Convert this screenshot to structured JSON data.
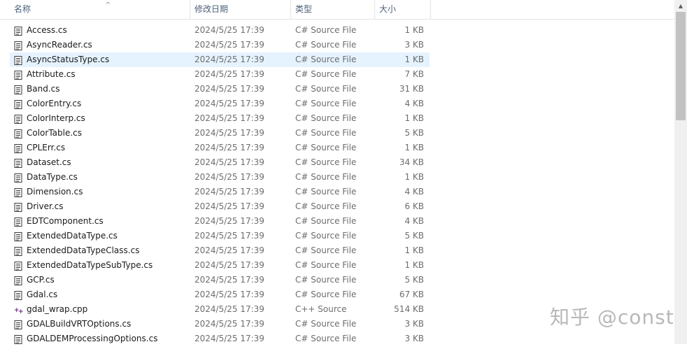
{
  "columns": {
    "name": "名称",
    "date": "修改日期",
    "type": "类型",
    "size": "大小"
  },
  "files": [
    {
      "name": "Access.cs",
      "date": "2024/5/25 17:39",
      "type": "C# Source File",
      "size": "1 KB",
      "icon": "cs-file-icon"
    },
    {
      "name": "AsyncReader.cs",
      "date": "2024/5/25 17:39",
      "type": "C# Source File",
      "size": "3 KB",
      "icon": "cs-file-icon"
    },
    {
      "name": "AsyncStatusType.cs",
      "date": "2024/5/25 17:39",
      "type": "C# Source File",
      "size": "1 KB",
      "icon": "cs-file-icon",
      "selected": true
    },
    {
      "name": "Attribute.cs",
      "date": "2024/5/25 17:39",
      "type": "C# Source File",
      "size": "7 KB",
      "icon": "cs-file-icon"
    },
    {
      "name": "Band.cs",
      "date": "2024/5/25 17:39",
      "type": "C# Source File",
      "size": "31 KB",
      "icon": "cs-file-icon"
    },
    {
      "name": "ColorEntry.cs",
      "date": "2024/5/25 17:39",
      "type": "C# Source File",
      "size": "4 KB",
      "icon": "cs-file-icon"
    },
    {
      "name": "ColorInterp.cs",
      "date": "2024/5/25 17:39",
      "type": "C# Source File",
      "size": "1 KB",
      "icon": "cs-file-icon"
    },
    {
      "name": "ColorTable.cs",
      "date": "2024/5/25 17:39",
      "type": "C# Source File",
      "size": "5 KB",
      "icon": "cs-file-icon"
    },
    {
      "name": "CPLErr.cs",
      "date": "2024/5/25 17:39",
      "type": "C# Source File",
      "size": "1 KB",
      "icon": "cs-file-icon"
    },
    {
      "name": "Dataset.cs",
      "date": "2024/5/25 17:39",
      "type": "C# Source File",
      "size": "34 KB",
      "icon": "cs-file-icon"
    },
    {
      "name": "DataType.cs",
      "date": "2024/5/25 17:39",
      "type": "C# Source File",
      "size": "1 KB",
      "icon": "cs-file-icon"
    },
    {
      "name": "Dimension.cs",
      "date": "2024/5/25 17:39",
      "type": "C# Source File",
      "size": "4 KB",
      "icon": "cs-file-icon"
    },
    {
      "name": "Driver.cs",
      "date": "2024/5/25 17:39",
      "type": "C# Source File",
      "size": "6 KB",
      "icon": "cs-file-icon"
    },
    {
      "name": "EDTComponent.cs",
      "date": "2024/5/25 17:39",
      "type": "C# Source File",
      "size": "4 KB",
      "icon": "cs-file-icon"
    },
    {
      "name": "ExtendedDataType.cs",
      "date": "2024/5/25 17:39",
      "type": "C# Source File",
      "size": "5 KB",
      "icon": "cs-file-icon"
    },
    {
      "name": "ExtendedDataTypeClass.cs",
      "date": "2024/5/25 17:39",
      "type": "C# Source File",
      "size": "1 KB",
      "icon": "cs-file-icon"
    },
    {
      "name": "ExtendedDataTypeSubType.cs",
      "date": "2024/5/25 17:39",
      "type": "C# Source File",
      "size": "1 KB",
      "icon": "cs-file-icon"
    },
    {
      "name": "GCP.cs",
      "date": "2024/5/25 17:39",
      "type": "C# Source File",
      "size": "5 KB",
      "icon": "cs-file-icon"
    },
    {
      "name": "Gdal.cs",
      "date": "2024/5/25 17:39",
      "type": "C# Source File",
      "size": "67 KB",
      "icon": "cs-file-icon"
    },
    {
      "name": "gdal_wrap.cpp",
      "date": "2024/5/25 17:39",
      "type": "C++ Source",
      "size": "514 KB",
      "icon": "cpp-file-icon"
    },
    {
      "name": "GDALBuildVRTOptions.cs",
      "date": "2024/5/25 17:39",
      "type": "C# Source File",
      "size": "3 KB",
      "icon": "cs-file-icon"
    },
    {
      "name": "GDALDEMProcessingOptions.cs",
      "date": "2024/5/25 17:39",
      "type": "C# Source File",
      "size": "3 KB",
      "icon": "cs-file-icon"
    }
  ],
  "watermark": "知乎 @const"
}
